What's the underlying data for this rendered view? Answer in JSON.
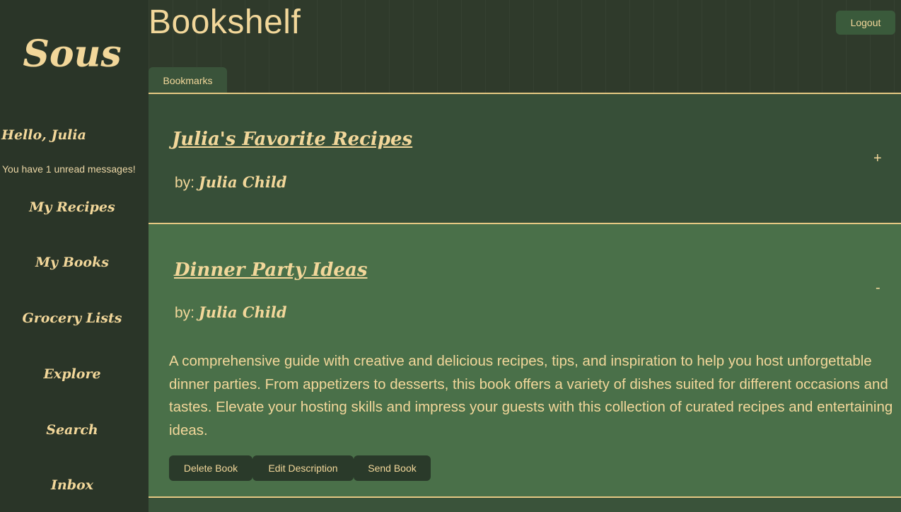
{
  "sidebar": {
    "brand": "Sous",
    "greeting": "Hello, Julia",
    "unread": "You have 1 unread messages!",
    "nav": [
      "My Recipes",
      "My Books",
      "Grocery Lists",
      "Explore",
      "Search",
      "Inbox"
    ]
  },
  "header": {
    "title": "Bookshelf",
    "logout_label": "Logout",
    "tab_label": "Bookmarks"
  },
  "books": [
    {
      "title": "Julia's Favorite Recipes",
      "by_prefix": "by:",
      "author": "Julia Child",
      "toggle": "+"
    },
    {
      "title": "Dinner Party Ideas",
      "by_prefix": "by:",
      "author": "Julia Child",
      "toggle": "-",
      "description": "A comprehensive guide with creative and delicious recipes, tips, and inspiration to help you host unforgettable dinner parties. From appetizers to desserts, this book offers a variety of dishes suited for different occasions and tastes. Elevate your hosting skills and impress your guests with this collection of curated recipes and entertaining ideas.",
      "actions": [
        "Delete Book",
        "Edit Description",
        "Send Book"
      ]
    }
  ],
  "colors": {
    "sidebar_bg": "#2a3528",
    "accent_text": "#f2d79a",
    "card_collapsed": "#374f38",
    "card_expanded": "#4a7049",
    "button_bg": "#2a3a2a"
  }
}
